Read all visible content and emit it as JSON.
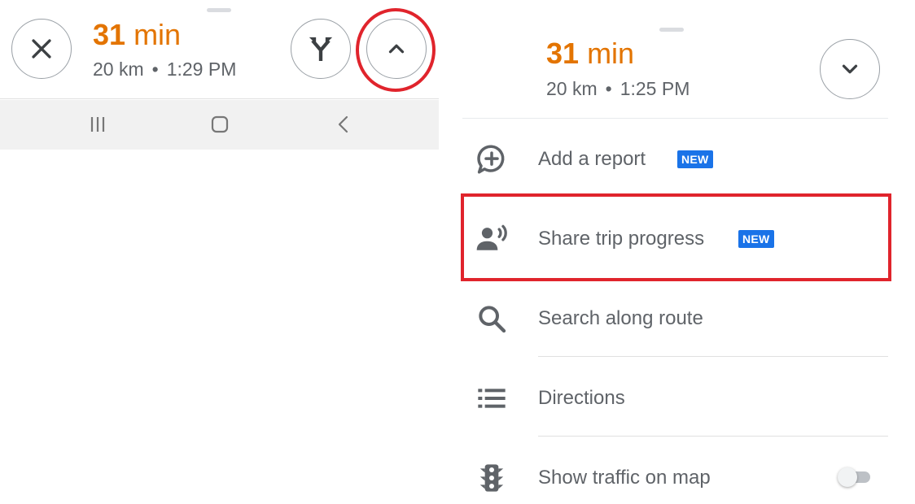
{
  "left": {
    "eta_value": "31",
    "eta_unit": "min",
    "distance": "20 km",
    "separator": "•",
    "arrival": "1:29 PM",
    "buttons": {
      "close_icon": "close-icon",
      "route_icon": "alternate-routes-icon",
      "expand_icon": "chevron-up-icon"
    },
    "highlight_color": "#e0242c"
  },
  "right": {
    "eta_value": "31",
    "eta_unit": "min",
    "distance": "20 km",
    "separator": "•",
    "arrival": "1:25 PM",
    "collapse_icon": "chevron-down-icon",
    "menu": [
      {
        "label": "Add a report",
        "badge": "NEW",
        "icon": "add-report-icon"
      },
      {
        "label": "Share trip progress",
        "badge": "NEW",
        "icon": "share-location-icon"
      },
      {
        "label": "Search along route",
        "icon": "search-icon"
      },
      {
        "label": "Directions",
        "icon": "list-icon"
      },
      {
        "label": "Show traffic on map",
        "icon": "traffic-light-icon",
        "toggle_on": false
      }
    ]
  },
  "system_nav": {
    "recents_icon": "recents-icon",
    "home_icon": "home-icon",
    "back_icon": "back-icon"
  },
  "colors": {
    "eta": "#e37400",
    "badge": "#1a73e8",
    "highlight": "#e0242c",
    "text_secondary": "#5f6368"
  }
}
